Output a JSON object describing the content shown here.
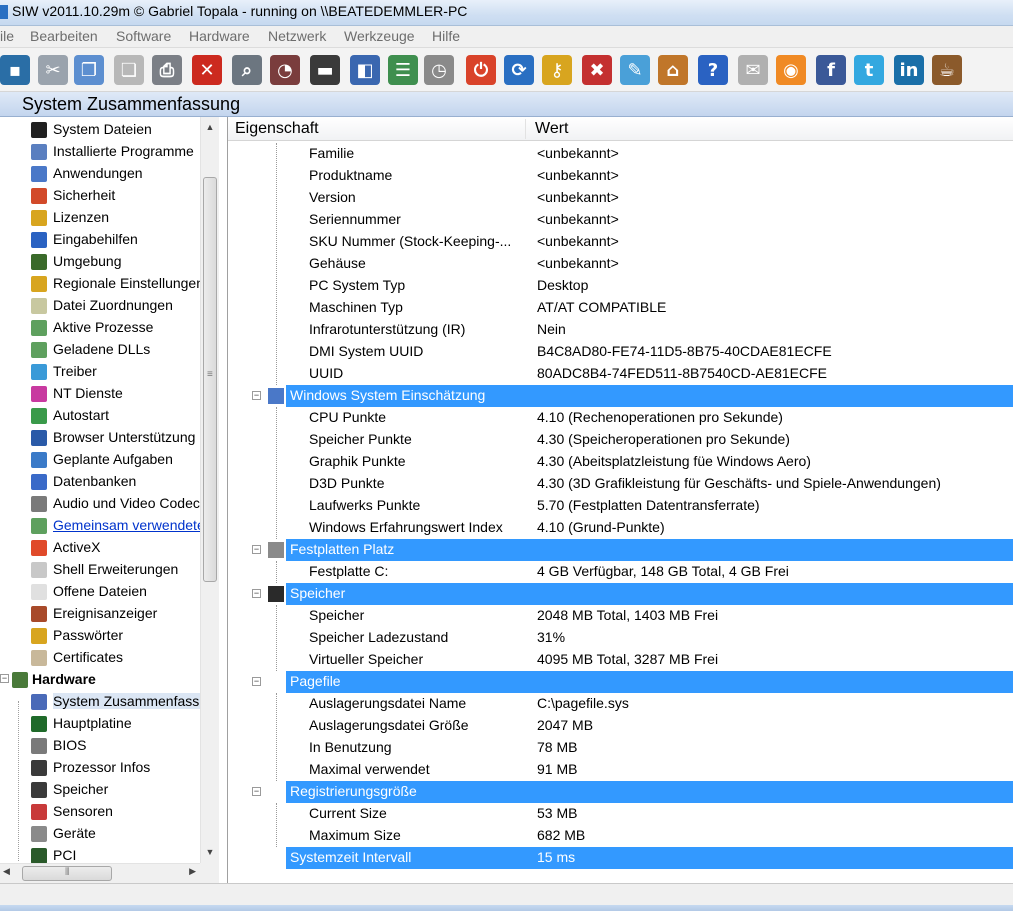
{
  "window": {
    "title": "SIW v2011.10.29m  © Gabriel Topala - running on \\\\BEATEDEMMLER-PC"
  },
  "menu": [
    "ile",
    "Bearbeiten",
    "Software",
    "Hardware",
    "Netzwerk",
    "Werkzeuge",
    "Hilfe"
  ],
  "toolbar": {
    "buttons": [
      {
        "icon": "save-icon",
        "glyph": "▪",
        "color": "#2a6ea6"
      },
      {
        "icon": "cut-icon",
        "glyph": "✂",
        "color": "#9aa3ad"
      },
      {
        "icon": "copy-icon",
        "glyph": "❐",
        "color": "#5d8fd0"
      },
      {
        "icon": "paste-icon",
        "glyph": "❏",
        "color": "#b8b8b8"
      },
      {
        "icon": "print-icon",
        "glyph": "⎙",
        "color": "#7b7f86"
      },
      {
        "icon": "stop-icon",
        "glyph": "✕",
        "color": "#cc2a1f"
      },
      {
        "icon": "search-icon",
        "glyph": "⌕",
        "color": "#6c7680"
      },
      {
        "icon": "gauge-icon",
        "glyph": "◔",
        "color": "#7a3d3d"
      },
      {
        "icon": "monitor-icon",
        "glyph": "▬",
        "color": "#3a3a3a"
      },
      {
        "icon": "network-icon",
        "glyph": "◧",
        "color": "#3a67b0"
      },
      {
        "icon": "list-icon",
        "glyph": "☰",
        "color": "#3f8f4f"
      },
      {
        "icon": "stopwatch-icon",
        "glyph": "◷",
        "color": "#8a8a8a"
      },
      {
        "icon": "shutdown-icon",
        "glyph": "⏻",
        "color": "#d9432a"
      },
      {
        "icon": "refresh-icon",
        "glyph": "⟳",
        "color": "#2a6fc2"
      },
      {
        "icon": "key-icon",
        "glyph": "⚷",
        "color": "#d8a51f"
      },
      {
        "icon": "tools-icon",
        "glyph": "✖",
        "color": "#c43030"
      },
      {
        "icon": "map-icon",
        "glyph": "✎",
        "color": "#4aa0d8"
      },
      {
        "icon": "home-icon",
        "glyph": "⌂",
        "color": "#c0762a"
      },
      {
        "icon": "help-icon",
        "glyph": "?",
        "color": "#2a62c2"
      },
      {
        "icon": "mail-icon",
        "glyph": "✉",
        "color": "#b0b0b0"
      },
      {
        "icon": "rss-icon",
        "glyph": "◉",
        "color": "#f08a24"
      },
      {
        "icon": "facebook-icon",
        "glyph": "f",
        "color": "#3b5998"
      },
      {
        "icon": "twitter-icon",
        "glyph": "t",
        "color": "#33a8e0"
      },
      {
        "icon": "linkedin-icon",
        "glyph": "in",
        "color": "#1a6fa8"
      },
      {
        "icon": "coffee-icon",
        "glyph": "☕",
        "color": "#8b5a2b"
      }
    ]
  },
  "section_title": "System Zusammenfassung",
  "tree": {
    "items": [
      {
        "label": "System Dateien",
        "icon": "console-icon",
        "color": "#202020"
      },
      {
        "label": "Installierte Programme",
        "icon": "install-icon",
        "color": "#5a7fc0"
      },
      {
        "label": "Anwendungen",
        "icon": "window-icon",
        "color": "#4a78c8"
      },
      {
        "label": "Sicherheit",
        "icon": "shield-icon",
        "color": "#d24a2a"
      },
      {
        "label": "Lizenzen",
        "icon": "lock-icon",
        "color": "#d8a51f"
      },
      {
        "label": "Eingabehilfen",
        "icon": "accessibility-icon",
        "color": "#2a62c2"
      },
      {
        "label": "Umgebung",
        "icon": "environment-icon",
        "color": "#3a6a2a"
      },
      {
        "label": "Regionale Einstellungen",
        "icon": "regional-icon",
        "color": "#d8a51f"
      },
      {
        "label": "Datei Zuordnungen",
        "icon": "file-assoc-icon",
        "color": "#c8c8a0"
      },
      {
        "label": "Aktive Prozesse",
        "icon": "process-icon",
        "color": "#5ea05e"
      },
      {
        "label": "Geladene DLLs",
        "icon": "dll-icon",
        "color": "#5ea05e"
      },
      {
        "label": "Treiber",
        "icon": "driver-icon",
        "color": "#3a9ad8"
      },
      {
        "label": "NT Dienste",
        "icon": "services-icon",
        "color": "#c83aa0"
      },
      {
        "label": "Autostart",
        "icon": "autostart-icon",
        "color": "#3a9a4a"
      },
      {
        "label": "Browser Unterstützung",
        "icon": "browser-icon",
        "color": "#2a5aa8"
      },
      {
        "label": "Geplante Aufgaben",
        "icon": "tasks-icon",
        "color": "#3a7ac8"
      },
      {
        "label": "Datenbanken",
        "icon": "database-icon",
        "color": "#3a6ac8"
      },
      {
        "label": "Audio und Video Codecs",
        "icon": "codec-icon",
        "color": "#7a7a7a"
      },
      {
        "label": "Gemeinsam verwendete DLLs",
        "icon": "shared-dll-icon",
        "color": "#5ea05e",
        "link": true
      },
      {
        "label": "ActiveX",
        "icon": "activex-icon",
        "color": "#e04a2a"
      },
      {
        "label": "Shell Erweiterungen",
        "icon": "shell-icon",
        "color": "#c8c8c8"
      },
      {
        "label": "Offene Dateien",
        "icon": "open-file-icon",
        "color": "#e0e0e0"
      },
      {
        "label": "Ereignisanzeiger",
        "icon": "event-icon",
        "color": "#a84a2a"
      },
      {
        "label": "Passwörter",
        "icon": "password-icon",
        "color": "#d8a51f"
      },
      {
        "label": "Certificates",
        "icon": "certificate-icon",
        "color": "#c8b89a"
      }
    ],
    "group": {
      "label": "Hardware",
      "icon": "hardware-icon",
      "color": "#4a7a3a"
    },
    "hw_items": [
      {
        "label": "System Zusammenfassung",
        "icon": "system-summary-icon",
        "color": "#4a6ab8",
        "selected": true
      },
      {
        "label": "Hauptplatine",
        "icon": "motherboard-icon",
        "color": "#1f6a2a"
      },
      {
        "label": "BIOS",
        "icon": "bios-icon",
        "color": "#7a7a7a"
      },
      {
        "label": "Prozessor Infos",
        "icon": "cpu-icon",
        "color": "#3a3a3a"
      },
      {
        "label": "Speicher",
        "icon": "memory-icon",
        "color": "#3a3a3a"
      },
      {
        "label": "Sensoren",
        "icon": "sensor-icon",
        "color": "#c83a3a"
      },
      {
        "label": "Geräte",
        "icon": "devices-icon",
        "color": "#8a8a8a"
      },
      {
        "label": "PCI",
        "icon": "pci-icon",
        "color": "#2a5a2a"
      }
    ]
  },
  "table": {
    "col_property": "Eigenschaft",
    "col_value": "Wert",
    "rows": [
      {
        "k": "Familie",
        "v": "<unbekannt>"
      },
      {
        "k": "Produktname",
        "v": "<unbekannt>"
      },
      {
        "k": "Version",
        "v": "<unbekannt>"
      },
      {
        "k": "Seriennummer",
        "v": "<unbekannt>"
      },
      {
        "k": "SKU Nummer (Stock-Keeping-...",
        "v": "<unbekannt>"
      },
      {
        "k": "Gehäuse",
        "v": "<unbekannt>"
      },
      {
        "k": "PC System Typ",
        "v": "Desktop"
      },
      {
        "k": "Maschinen Typ",
        "v": "AT/AT COMPATIBLE"
      },
      {
        "k": "Infrarotunterstützung (IR)",
        "v": "Nein"
      },
      {
        "k": "DMI System UUID",
        "v": "B4C8AD80-FE74-11D5-8B75-40CDAE81ECFE"
      },
      {
        "k": "UUID",
        "v": "80ADC8B4-74FED511-8B7540CD-AE81ECFE"
      },
      {
        "k": "Windows System Einschätzung",
        "v": "",
        "group": true,
        "icon": "rating-icon"
      },
      {
        "k": "CPU Punkte",
        "v": "4.10 (Rechenoperationen pro Sekunde)"
      },
      {
        "k": "Speicher Punkte",
        "v": "4.30 (Speicheroperationen pro Sekunde)"
      },
      {
        "k": "Graphik Punkte",
        "v": "4.30 (Abeitsplatzleistung füe Windows Aero)"
      },
      {
        "k": "D3D Punkte",
        "v": "4.30 (3D Grafikleistung für Geschäfts- und Spiele-Anwendungen)"
      },
      {
        "k": "Laufwerks Punkte",
        "v": "5.70 (Festplatten Datentransferrate)"
      },
      {
        "k": "Windows Erfahrungswert Index",
        "v": "4.10 (Grund-Punkte)"
      },
      {
        "k": "Festplatten Platz",
        "v": "",
        "group": true,
        "icon": "disk-icon"
      },
      {
        "k": "Festplatte C:",
        "v": "4 GB Verfügbar, 148 GB Total, 4 GB Frei"
      },
      {
        "k": "Speicher",
        "v": "",
        "group": true,
        "icon": "memory-chip-icon"
      },
      {
        "k": "Speicher",
        "v": "2048 MB Total, 1403 MB Frei"
      },
      {
        "k": "Speicher Ladezustand",
        "v": "31%"
      },
      {
        "k": "Virtueller Speicher",
        "v": "4095 MB Total, 3287 MB Frei"
      },
      {
        "k": "Pagefile",
        "v": "",
        "group": true,
        "icon": ""
      },
      {
        "k": "Auslagerungsdatei Name",
        "v": "C:\\pagefile.sys"
      },
      {
        "k": "Auslagerungsdatei Größe",
        "v": "2047 MB"
      },
      {
        "k": "In Benutzung",
        "v": "78 MB"
      },
      {
        "k": "Maximal verwendet",
        "v": "91 MB"
      },
      {
        "k": "Registrierungsgröße",
        "v": "",
        "group": true,
        "icon": ""
      },
      {
        "k": "Current Size",
        "v": "53 MB"
      },
      {
        "k": "Maximum Size",
        "v": "682 MB"
      },
      {
        "k": "Systemzeit Intervall",
        "v": "15 ms",
        "group": true,
        "icon": "",
        "flat": true
      }
    ]
  }
}
